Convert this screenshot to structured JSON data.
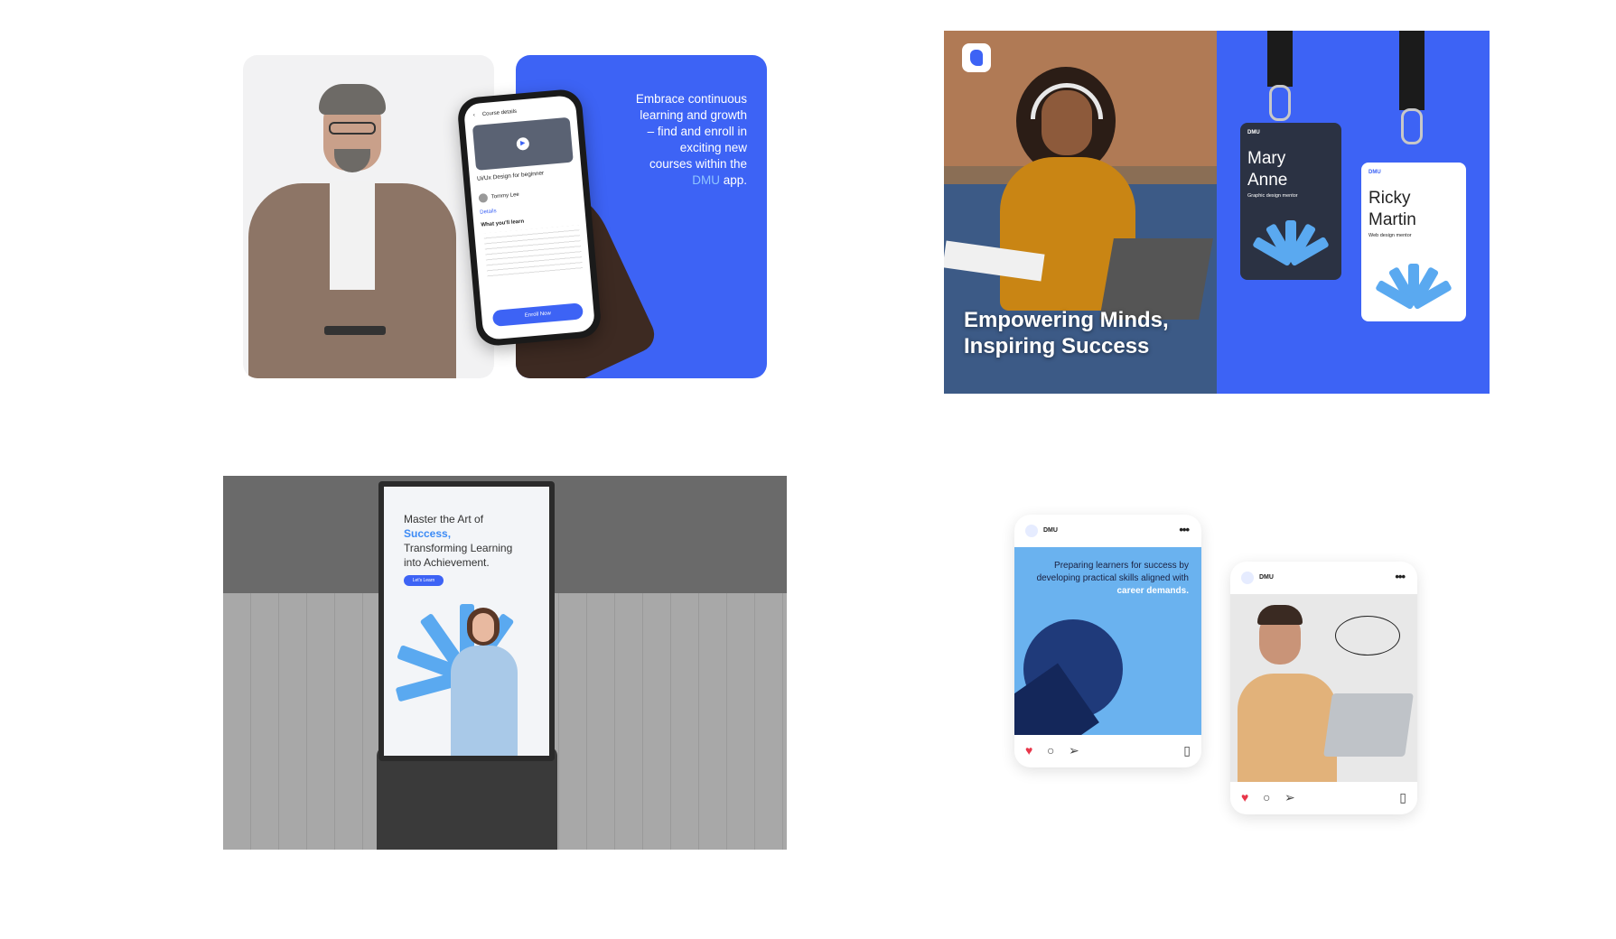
{
  "panel1": {
    "tagline_lines": [
      "Embrace continuous",
      "learning and growth",
      "– find and enroll in",
      "exciting new",
      "courses within the"
    ],
    "tagline_brand": "DMU",
    "tagline_end": "app.",
    "phone": {
      "header": "Course details",
      "course_title": "Ui/Ux Design for beginner",
      "instructor": "Tommy Lee",
      "tab": "Details",
      "section": "What you'll learn",
      "cta": "Enroll Now"
    }
  },
  "panel2": {
    "headline_line1": "Empowering Minds,",
    "headline_line2": "Inspiring Success",
    "badges": [
      {
        "brand": "DMU",
        "name_line1": "Mary",
        "name_line2": "Anne",
        "role": "Graphic design mentor"
      },
      {
        "brand": "DMU",
        "name_line1": "Ricky",
        "name_line2": "Martin",
        "role": "Web design mentor"
      }
    ]
  },
  "panel3": {
    "title_line1": "Master the Art of",
    "title_highlight": "Success,",
    "title_line3": "Transforming Learning",
    "title_line4": "into Achievement.",
    "button": "Let's Learn"
  },
  "panel4": {
    "posts": [
      {
        "account": "DMU",
        "text": "Preparing learners for success by developing practical skills aligned with",
        "highlight": "career demands."
      },
      {
        "account": "DMU"
      }
    ]
  },
  "colors": {
    "brand_blue": "#3d63f5",
    "light_blue": "#5aa9f0",
    "heart": "#e8364a"
  },
  "icons": [
    "heart-icon",
    "comment-icon",
    "send-icon",
    "bookmark-icon",
    "more-icon",
    "dmu-logo-icon"
  ]
}
